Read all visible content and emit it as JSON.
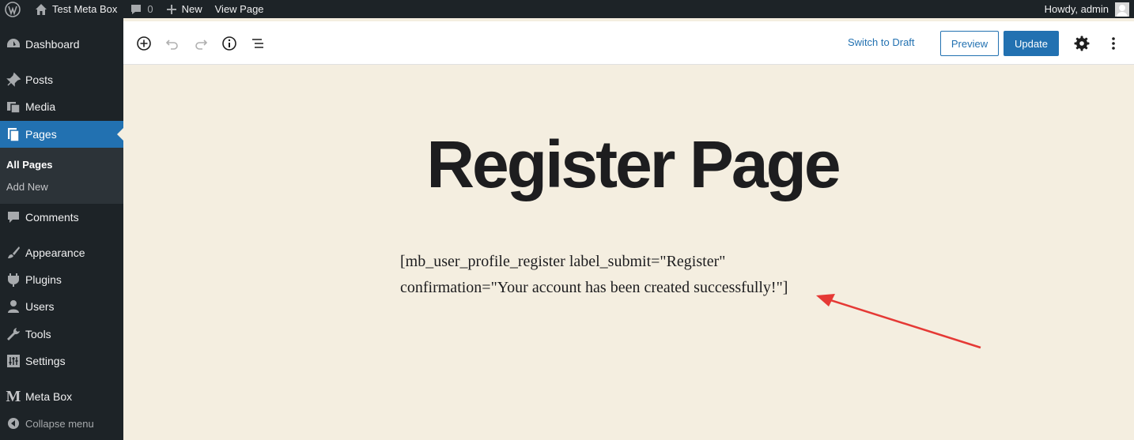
{
  "admin_bar": {
    "site_name": "Test Meta Box",
    "comments_count": "0",
    "new_label": "New",
    "view_page_label": "View Page",
    "howdy": "Howdy, admin"
  },
  "sidebar": {
    "items": [
      {
        "label": "Dashboard",
        "icon": "dashboard-icon"
      },
      {
        "label": "Posts",
        "icon": "pin-icon"
      },
      {
        "label": "Media",
        "icon": "media-icon"
      },
      {
        "label": "Pages",
        "icon": "pages-icon",
        "active": true
      },
      {
        "label": "Comments",
        "icon": "comment-icon"
      },
      {
        "label": "Appearance",
        "icon": "brush-icon"
      },
      {
        "label": "Plugins",
        "icon": "plugin-icon"
      },
      {
        "label": "Users",
        "icon": "user-icon"
      },
      {
        "label": "Tools",
        "icon": "wrench-icon"
      },
      {
        "label": "Settings",
        "icon": "settings-icon"
      },
      {
        "label": "Meta Box",
        "icon": "meta-box-logo"
      }
    ],
    "submenu": [
      "All Pages",
      "Add New"
    ],
    "collapse_label": "Collapse menu"
  },
  "editor_header": {
    "switch_to_draft": "Switch to Draft",
    "preview": "Preview",
    "update": "Update"
  },
  "content": {
    "title": "Register Page",
    "shortcode_line1": "[mb_user_profile_register label_submit=\"Register\"",
    "shortcode_line2": "confirmation=\"Your account has been created successfully!\"]"
  },
  "colors": {
    "admin_dark": "#1d2327",
    "accent": "#2271b1",
    "canvas": "#f4eee0",
    "annotation_arrow": "#e53935"
  }
}
